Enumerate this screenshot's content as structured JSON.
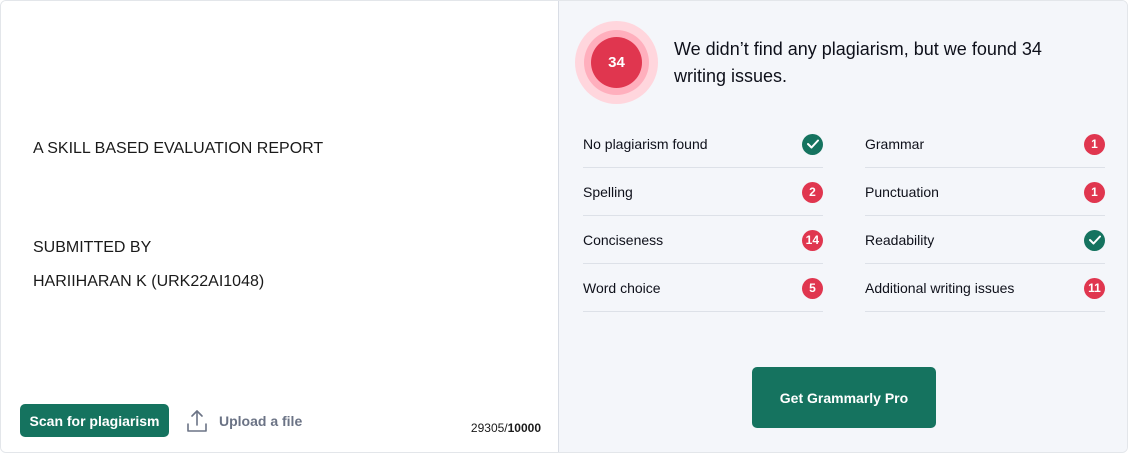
{
  "document": {
    "lines": [
      "A SKILL BASED EVALUATION REPORT",
      "SUBMITTED BY",
      "HARIIHARAN K (URK22AI1048)"
    ]
  },
  "toolbar": {
    "scan_label": "Scan for plagiarism",
    "upload_label": "Upload a file",
    "upload_icon": "upload-icon"
  },
  "counter": {
    "used": "29305/",
    "limit": "10000"
  },
  "result": {
    "score": "34",
    "headline": "We didn’t find any plagiarism, but we found 34 writing issues."
  },
  "issues": {
    "left": [
      {
        "label": "No plagiarism found",
        "status": "check"
      },
      {
        "label": "Spelling",
        "count": "2"
      },
      {
        "label": "Conciseness",
        "count": "14"
      },
      {
        "label": "Word choice",
        "count": "5"
      }
    ],
    "right": [
      {
        "label": "Grammar",
        "count": "1"
      },
      {
        "label": "Punctuation",
        "count": "1"
      },
      {
        "label": "Readability",
        "status": "check"
      },
      {
        "label": "Additional writing issues",
        "count": "11"
      }
    ]
  },
  "cta": {
    "label": "Get Grammarly Pro"
  },
  "colors": {
    "accent": "#15735f",
    "alert": "#e0364f",
    "panel": "#f4f6fa"
  }
}
